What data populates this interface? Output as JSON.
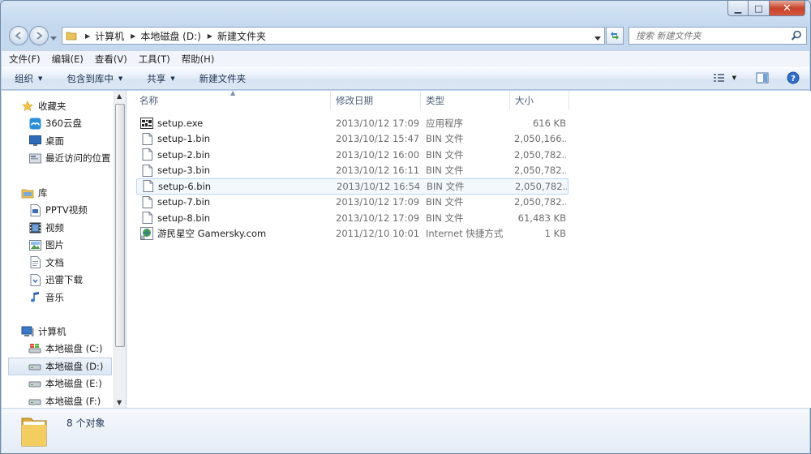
{
  "window": {
    "caption": {
      "minimize": "▁",
      "maximize": "□",
      "close": "✕"
    }
  },
  "address": {
    "crumbs": [
      "计算机",
      "本地磁盘 (D:)",
      "新建文件夹"
    ]
  },
  "search": {
    "placeholder": "搜索 新建文件夹"
  },
  "menu": [
    "文件(F)",
    "编辑(E)",
    "查看(V)",
    "工具(T)",
    "帮助(H)"
  ],
  "toolbar": {
    "organize": "组织",
    "include_library": "包含到库中",
    "share": "共享",
    "new_folder": "新建文件夹"
  },
  "navpane": {
    "favorites": {
      "label": "收藏夹",
      "items": [
        "360云盘",
        "桌面",
        "最近访问的位置"
      ]
    },
    "libraries": {
      "label": "库",
      "items": [
        "PPTV视频",
        "视频",
        "图片",
        "文档",
        "迅雷下载",
        "音乐"
      ]
    },
    "computer": {
      "label": "计算机",
      "items": [
        "本地磁盘 (C:)",
        "本地磁盘 (D:)",
        "本地磁盘 (E:)",
        "本地磁盘 (F:)"
      ],
      "selected_index": 1
    }
  },
  "columns": [
    "名称",
    "修改日期",
    "类型",
    "大小"
  ],
  "files": [
    {
      "name": "setup.exe",
      "date": "2013/10/12 17:09",
      "type": "应用程序",
      "size": "616 KB",
      "icon": "exe-icon"
    },
    {
      "name": "setup-1.bin",
      "date": "2013/10/12 15:47",
      "type": "BIN 文件",
      "size": "2,050,166...",
      "icon": "file-icon"
    },
    {
      "name": "setup-2.bin",
      "date": "2013/10/12 16:00",
      "type": "BIN 文件",
      "size": "2,050,782...",
      "icon": "file-icon"
    },
    {
      "name": "setup-3.bin",
      "date": "2013/10/12 16:11",
      "type": "BIN 文件",
      "size": "2,050,782...",
      "icon": "file-icon"
    },
    {
      "name": "setup-6.bin",
      "date": "2013/10/12 16:54",
      "type": "BIN 文件",
      "size": "2,050,782...",
      "icon": "file-icon"
    },
    {
      "name": "setup-7.bin",
      "date": "2013/10/12 17:09",
      "type": "BIN 文件",
      "size": "2,050,782...",
      "icon": "file-icon"
    },
    {
      "name": "setup-8.bin",
      "date": "2013/10/12 17:09",
      "type": "BIN 文件",
      "size": "61,483 KB",
      "icon": "file-icon"
    },
    {
      "name": "游民星空 Gamersky.com",
      "date": "2011/12/10 10:01",
      "type": "Internet 快捷方式",
      "size": "1 KB",
      "icon": "internet-shortcut-icon"
    }
  ],
  "hover_row": 4,
  "status": {
    "count": "8 个对象"
  }
}
